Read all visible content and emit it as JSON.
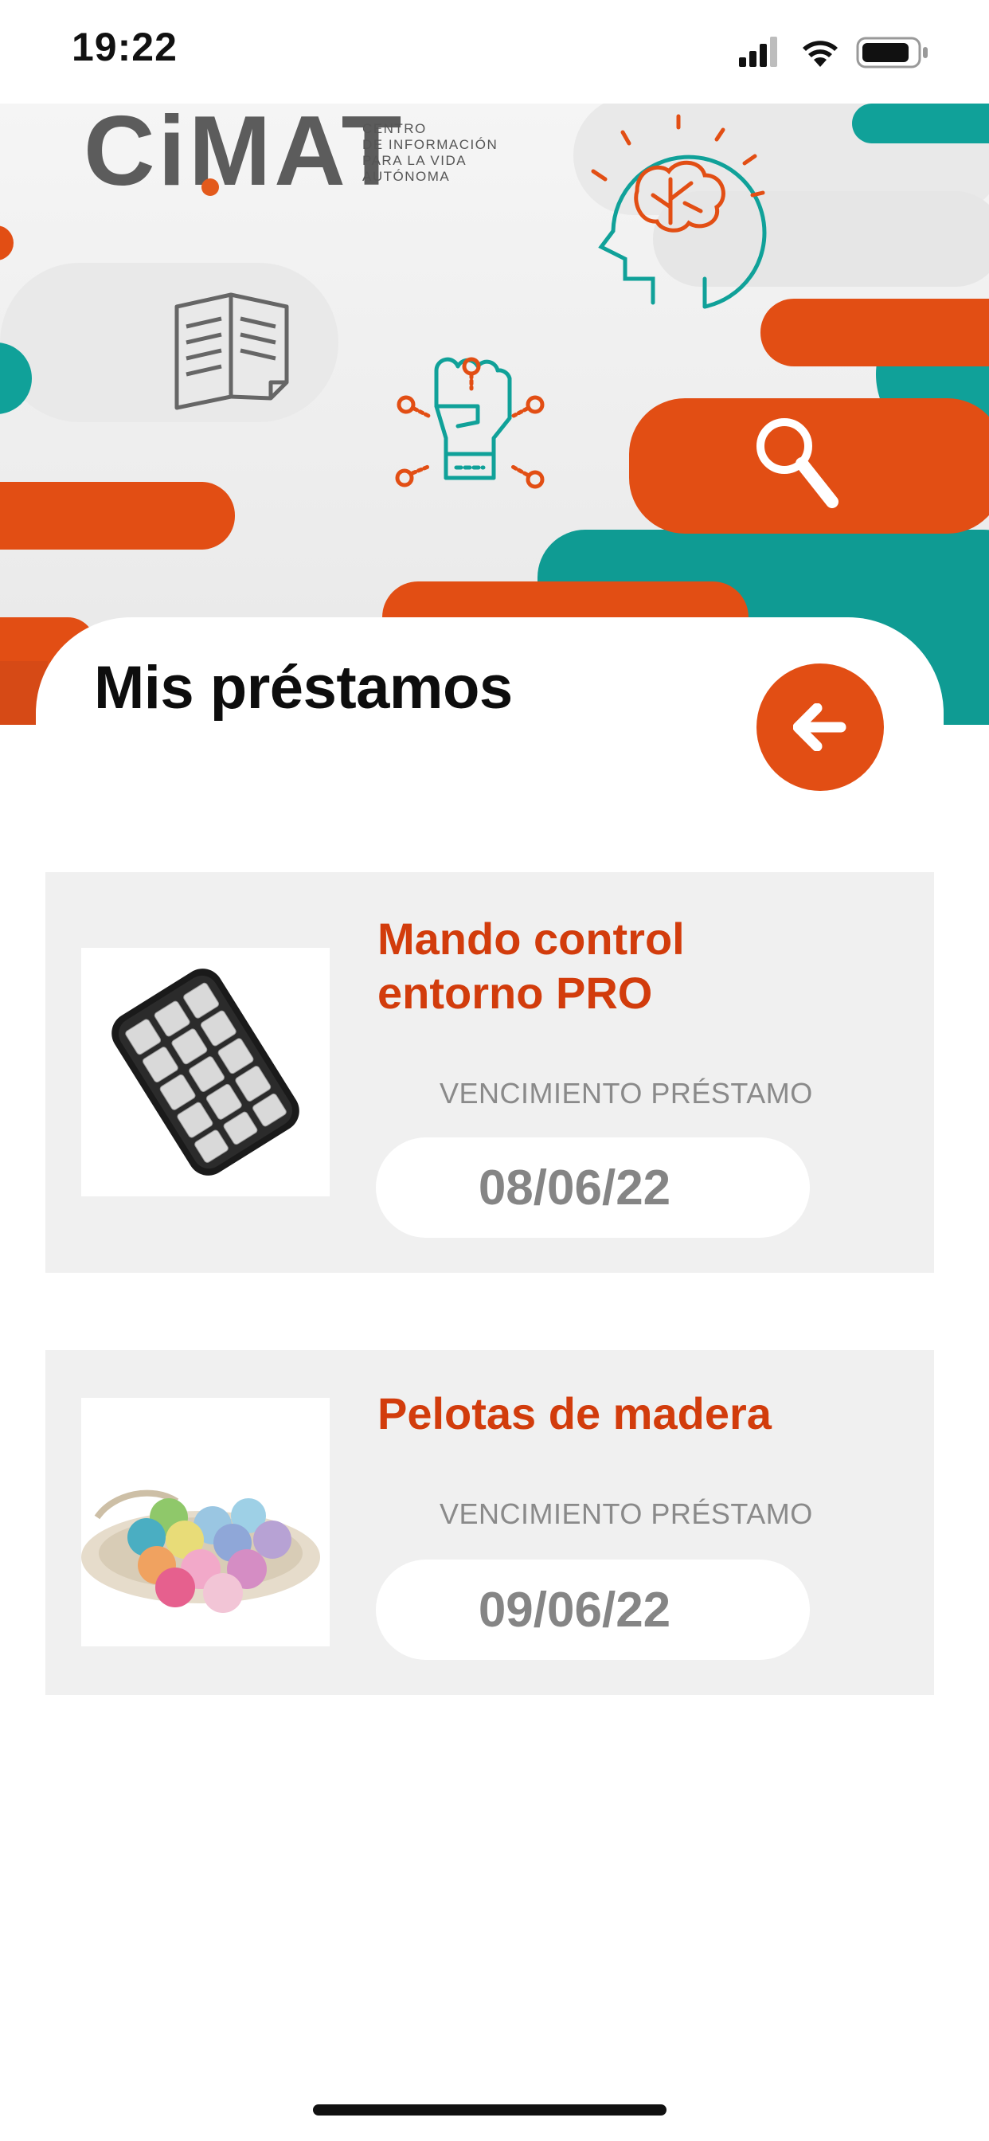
{
  "status_bar": {
    "time": "19:22",
    "icons": [
      "signal-icon",
      "wifi-icon",
      "battery-icon"
    ]
  },
  "logo": {
    "name": "CiMAT",
    "subtitle": [
      "CENTRO",
      "DE INFORMACIÓN",
      "PARA LA VIDA",
      "AUTÓNOMA"
    ]
  },
  "header": {
    "title": "Mis préstamos",
    "back_icon": "arrow-left-icon",
    "illustration_icons": [
      "document-icon",
      "head-brain-icon",
      "fist-icon",
      "magnifier-icon"
    ]
  },
  "loans": [
    {
      "name": "Mando control entorno PRO",
      "due_label": "VENCIMIENTO PRÉSTAMO",
      "due_date": "08/06/22",
      "image": "remote-control-image"
    },
    {
      "name": "Pelotas de madera",
      "due_label": "VENCIMIENTO PRÉSTAMO",
      "due_date": "09/06/22",
      "image": "wooden-balls-image"
    }
  ],
  "colors": {
    "accent": "#e24e14",
    "teal": "#10a199",
    "title_red": "#d23c0c",
    "card_bg": "#f0f0f0",
    "grey": "#858585"
  }
}
